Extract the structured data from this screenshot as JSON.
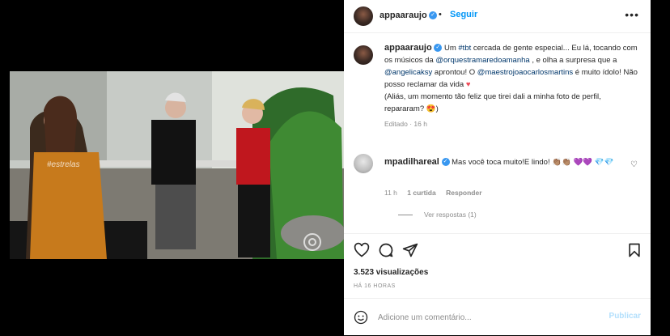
{
  "post": {
    "username": "appaaraujo",
    "follow_label": "Seguir",
    "dot": "•"
  },
  "caption": {
    "username": "appaaraujo",
    "parts": {
      "p1": " Um ",
      "tag_tbt": "#tbt",
      "p2": " cercada de gente especial... Eu lá, tocando com os músicos da ",
      "mention_orquestra": "@orquestramaredoamanha",
      "p3": " , e olha a surpresa que a ",
      "mention_angelica": "@angelicaksy",
      "p4": " aprontou! O ",
      "mention_maestro": "@maestrojoaocarlosmartins",
      "p5": " é muito ídolo! Não posso reclamar da vida ",
      "heart": "♥",
      "p6": "(Aliás, um momento tão feliz que tirei dali a minha foto de perfil, repararam? ",
      "emoji": "😍",
      "p7": ")"
    },
    "meta": "Editado · 16 h"
  },
  "comment": {
    "username": "mpadilhareal",
    "text": " Mas você toca muito!E lindo! 👏🏽👏🏽 💜💜 💎💎",
    "time": "11 h",
    "likes": "1 curtida",
    "reply": "Responder",
    "view_replies": "Ver respostas (1)"
  },
  "video": {
    "watermark": "#estrelas"
  },
  "stats": {
    "views": "3.523 visualizações",
    "time_ago": "HÁ 16 HORAS"
  },
  "add_comment": {
    "placeholder": "Adicione um comentário...",
    "publish_label": "Publicar"
  },
  "colors": {
    "link": "#00376b",
    "follow": "#0095f6",
    "verified": "#3897f0",
    "publish_disabled": "#b2dffc"
  }
}
